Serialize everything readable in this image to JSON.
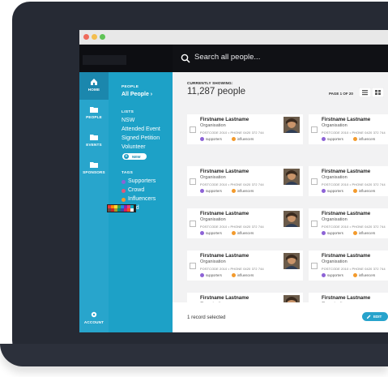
{
  "search": {
    "placeholder": "Search all people..."
  },
  "nav": {
    "home": "HOME",
    "people": "PEOPLE",
    "events": "EVENTS",
    "sponsors": "SPONSORS",
    "account": "ACCOUNT"
  },
  "panel": {
    "people_heading": "PEOPLE",
    "all_people": "All People",
    "lists_heading": "LISTS",
    "lists": [
      "NSW",
      "Attended Event",
      "Signed Petition",
      "Volunteer"
    ],
    "new_label": "NEW",
    "tags_heading": "TAGS",
    "tags": [
      {
        "label": "Supporters",
        "color": "#8d63d6"
      },
      {
        "label": "Crowd",
        "color": "#e05a7a"
      },
      {
        "label": "Influencers",
        "color": "#f39a2c"
      },
      {
        "label": "ated",
        "color": "#4caf50"
      }
    ]
  },
  "main": {
    "currently_showing": "CURRENTLY SHOWING:",
    "count": "11,287 people",
    "page_label": "PAGE 1 OF 20",
    "card": {
      "name": "Firstname Lastname",
      "org": "Organisation",
      "meta": "POSTCODE 2010  •  PHONE 0420 372 744",
      "tag1": "supporters",
      "tag2": "influencers"
    },
    "selected": "1 record selected",
    "edit": "EDIT"
  },
  "colors": {
    "nav_blue": "#28a5cc",
    "panel_blue": "#1da1c7",
    "supporters": "#8d63d6",
    "influencers": "#f39a2c"
  }
}
